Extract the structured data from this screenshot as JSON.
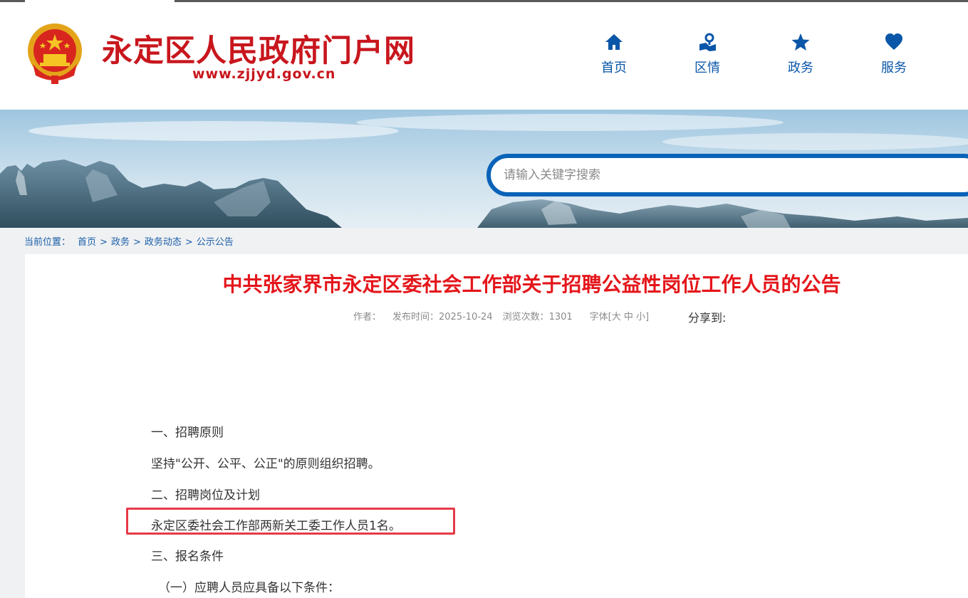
{
  "header": {
    "site_title": "永定区人民政府门户网",
    "site_url": "www.zjjyd.gov.cn",
    "nav": [
      {
        "label": "首页",
        "icon": "home-icon"
      },
      {
        "label": "区情",
        "icon": "map-pin-icon"
      },
      {
        "label": "政务",
        "icon": "star-icon"
      },
      {
        "label": "服务",
        "icon": "heart-icon"
      }
    ]
  },
  "search": {
    "placeholder": "请输入关键字搜索"
  },
  "breadcrumb": {
    "label": "当前位置：",
    "items": [
      "首页",
      "政务",
      "政务动态",
      "公示公告"
    ],
    "separator": ">"
  },
  "article": {
    "title": "中共张家界市永定区委社会工作部关于招聘公益性岗位工作人员的公告",
    "meta": {
      "author": "作者：",
      "publish": "发布时间：2025-10-24",
      "views": "浏览次数：1301",
      "font": "字体[大 中 小]"
    },
    "share": "分享到:",
    "paragraphs": [
      "一、招聘原则",
      "坚持\"公开、公平、公正\"的原则组织招聘。",
      "二、招聘岗位及计划",
      "永定区委社会工作部两新关工委工作人员1名。",
      "三、报名条件",
      "（一）应聘人员应具备以下条件："
    ]
  },
  "colors": {
    "brand_red": "#c8161d",
    "title_red": "#e4161b",
    "nav_blue": "#0a56a8",
    "search_border": "#0a63b8",
    "highlight": "#e53a47"
  }
}
